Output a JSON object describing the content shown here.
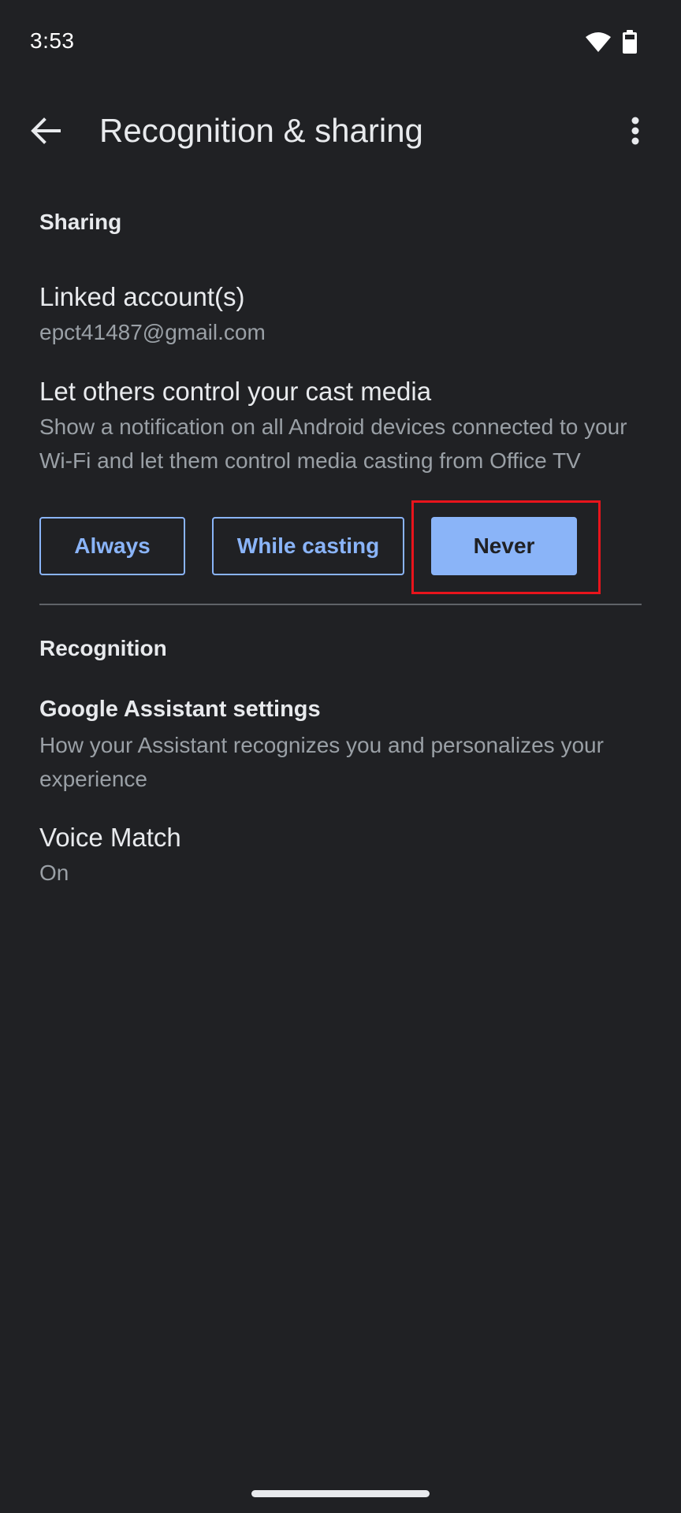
{
  "status_bar": {
    "time": "3:53",
    "icons": [
      "wifi-icon",
      "battery-icon"
    ]
  },
  "app_bar": {
    "title": "Recognition & sharing",
    "back_icon": "arrow-back-icon",
    "overflow_icon": "more-vert-icon"
  },
  "sharing": {
    "header": "Sharing",
    "linked_accounts": {
      "title": "Linked account(s)",
      "summary": "epct41487@gmail.com"
    },
    "cast_control": {
      "title": "Let others control your cast media",
      "summary": "Show a notification on all Android devices connected to your Wi-Fi and let them control media casting from Office TV",
      "options": [
        "Always",
        "While casting",
        "Never"
      ],
      "selected": "Never"
    }
  },
  "recognition": {
    "header": "Recognition",
    "assistant_settings": {
      "title": "Google Assistant settings",
      "summary": "How your Assistant recognizes you and personalizes your experience"
    },
    "voice_match": {
      "title": "Voice Match",
      "summary": "On"
    }
  },
  "colors": {
    "background": "#202124",
    "accent": "#8ab4f8",
    "highlight": "#e8141c",
    "secondary_text": "#9aa0a6"
  }
}
